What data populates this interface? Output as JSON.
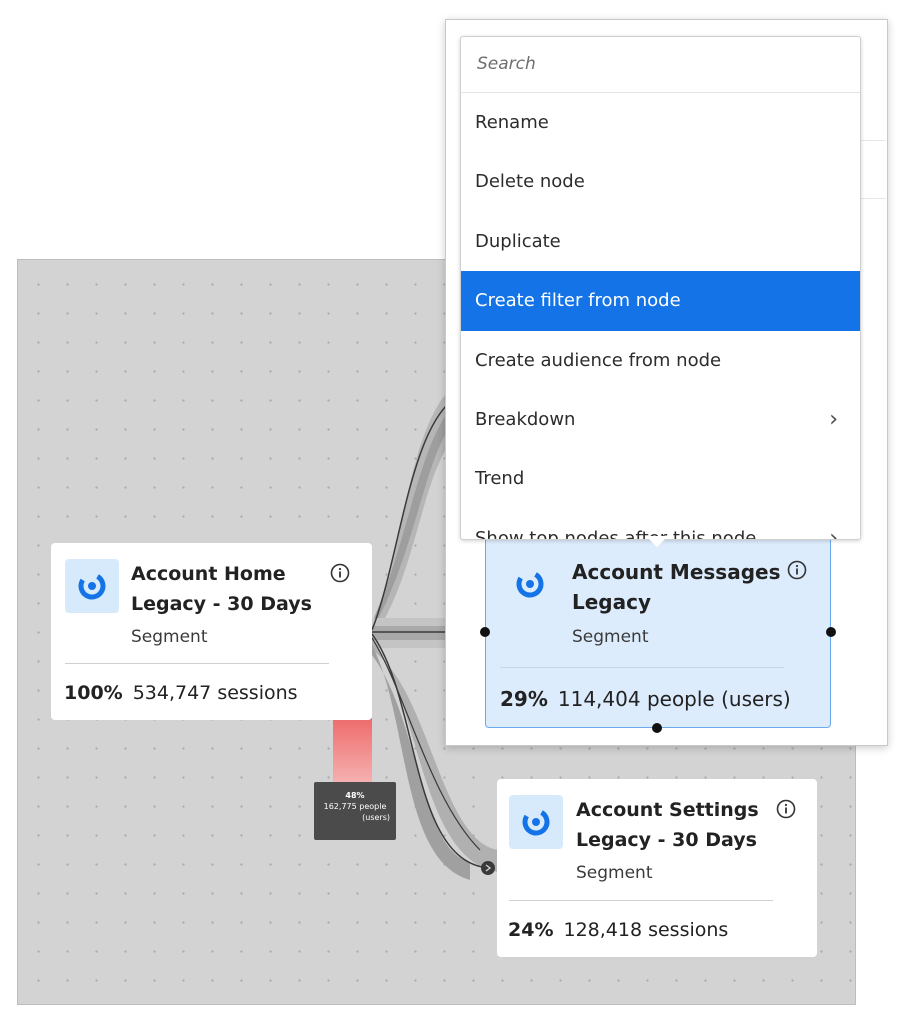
{
  "menu": {
    "search_placeholder": "Search",
    "items": [
      {
        "label": "Rename"
      },
      {
        "label": "Delete node"
      },
      {
        "label": "Duplicate"
      },
      {
        "label": "Create filter from node"
      },
      {
        "label": "Create audience from node"
      },
      {
        "label": "Breakdown"
      },
      {
        "label": "Trend"
      },
      {
        "label": "Show top nodes after this node"
      }
    ]
  },
  "nodes": {
    "home": {
      "title_line1": "Account Home",
      "title_line2": "Legacy - 30 Days",
      "type": "Segment",
      "percent": "100%",
      "count": "534,747 sessions",
      "icon": "segment-icon"
    },
    "messages": {
      "title_line1": "Account Messages",
      "title_line2": "Legacy",
      "type": "Segment",
      "percent": "29%",
      "count": "114,404 people (users)",
      "icon": "segment-icon"
    },
    "settings": {
      "title_line1": "Account Settings",
      "title_line2": "Legacy - 30 Days",
      "type": "Segment",
      "percent": "24%",
      "count": "128,418 sessions",
      "icon": "segment-icon"
    }
  },
  "tooltip": {
    "percent": "48%",
    "line1": "162,775 people",
    "line2": "(users)"
  },
  "colors": {
    "accent": "#1473e6",
    "selected_node_bg": "#dcecfc",
    "icon_blue": "#1473e6",
    "dropoff": "#ee7070"
  }
}
